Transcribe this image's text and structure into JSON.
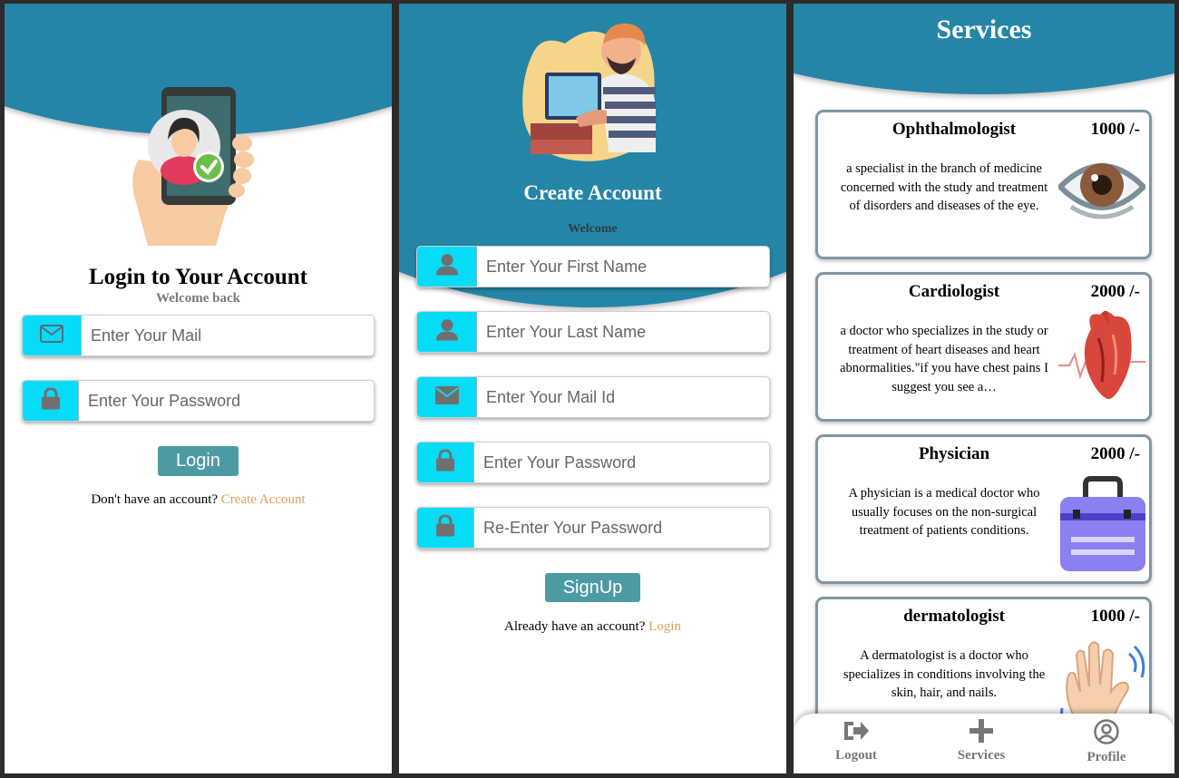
{
  "login": {
    "title": "Login to Your Account",
    "subtitle": "Welcome back",
    "email_placeholder": "Enter Your Mail",
    "password_placeholder": "Enter Your Password",
    "login_button": "Login",
    "footer_text": "Don't have an account?",
    "footer_link": "Create Account"
  },
  "signup": {
    "title": "Create Account",
    "subtitle": "Welcome",
    "first_name_placeholder": "Enter Your First Name",
    "last_name_placeholder": "Enter Your Last Name",
    "mail_placeholder": "Enter Your Mail Id",
    "password_placeholder": "Enter Your Password",
    "reenter_placeholder": "Re-Enter Your Password",
    "signup_button": "SignUp",
    "footer_text": "Already have an account?",
    "footer_link": "Login"
  },
  "services": {
    "title": "Services",
    "cards": [
      {
        "name": "Ophthalmologist",
        "price": "1000 /-",
        "description": "a specialist in the branch of medicine concerned with the study and treatment of disorders and diseases of the eye.",
        "icon": "eye-icon"
      },
      {
        "name": "Cardiologist",
        "price": "2000 /-",
        "description": "a doctor who specializes in the study or treatment of heart diseases and heart abnormalities.\"if you have chest pains I suggest you see a…",
        "icon": "heart-icon"
      },
      {
        "name": "Physician",
        "price": "2000 /-",
        "description": "A physician is a medical doctor who usually focuses on the non-surgical treatment of patients conditions.",
        "icon": "medical-bag-icon"
      },
      {
        "name": "dermatologist",
        "price": "1000 /-",
        "description": "A dermatologist is a doctor who specializes in conditions involving the skin, hair, and nails.",
        "icon": "waving-hand-icon"
      }
    ],
    "nav": {
      "logout": "Logout",
      "services": "Services",
      "profile": "Profile"
    }
  },
  "colors": {
    "header_blue": "#2585a6",
    "icon_cyan": "#06dcf7",
    "button_teal": "#4c9aa4",
    "link_gold": "#d9a25a"
  }
}
